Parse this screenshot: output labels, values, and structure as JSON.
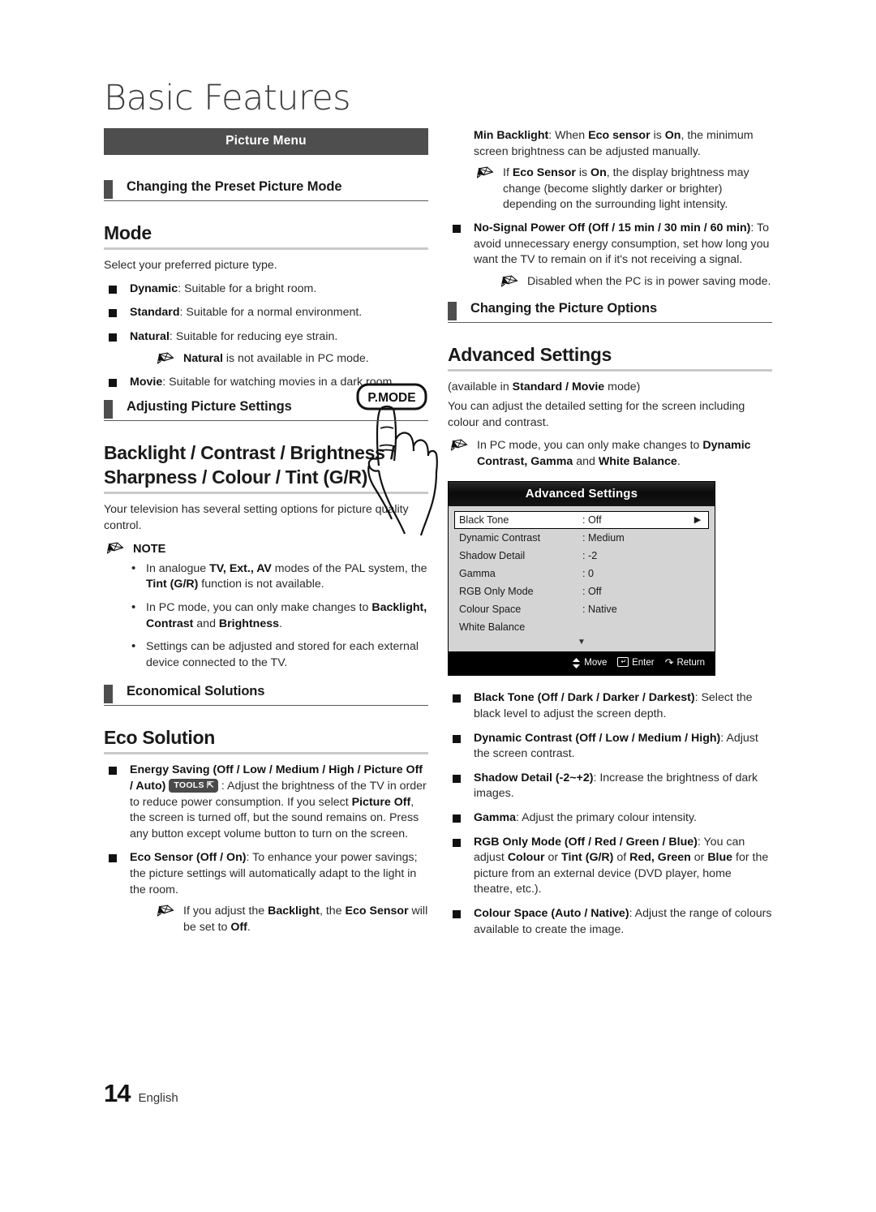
{
  "document": {
    "title": "Basic Features",
    "page_number": "14",
    "language": "English"
  },
  "left_column": {
    "banner": "Picture Menu",
    "section1": {
      "heading": "Changing the Preset Picture Mode",
      "title": "Mode",
      "intro": "Select your preferred picture type.",
      "button_icon_label": "P.MODE",
      "items": [
        {
          "term": "Dynamic",
          "desc": ": Suitable for a bright room."
        },
        {
          "term": "Standard",
          "desc": ": Suitable for a normal environment."
        },
        {
          "term": "Natural",
          "desc": ": Suitable for reducing eye strain."
        },
        {
          "term": "Movie",
          "desc": ": Suitable for watching movies in a dark room."
        }
      ],
      "natural_note_pre": "",
      "natural_note_bold": "Natural",
      "natural_note_post": " is not available in PC mode."
    },
    "section2": {
      "heading": "Adjusting Picture Settings",
      "title_line1": "Backlight / Contrast / Brightness /",
      "title_line2": "Sharpness / Colour / Tint (G/R)",
      "intro": "Your television has several setting options for picture quality control.",
      "note_label": "NOTE",
      "notes": [
        "In analogue TV, Ext., AV modes of the PAL system, the Tint (G/R) function is not available.",
        "In PC mode, you can only make changes to Backlight, Contrast and Brightness.",
        "Settings can be adjusted and stored for each external device connected to the TV."
      ]
    },
    "section3": {
      "heading": "Economical Solutions",
      "title": "Eco Solution",
      "energy_saving": {
        "term": "Energy Saving (Off / Low / Medium / High / Picture Off / Auto)",
        "badge": "TOOLS",
        "desc": ": Adjust the brightness of the TV in order to reduce power consumption. If you select Picture Off, the screen is turned off, but the sound remains on. Press any button except volume button to turn on the screen."
      },
      "eco_sensor": {
        "term": "Eco Sensor (Off / On)",
        "desc": ": To enhance your power savings; the picture settings will automatically adapt to the light in the room."
      },
      "eco_sensor_note": "If you adjust the Backlight, the Eco Sensor will be set to Off."
    }
  },
  "right_column": {
    "min_backlight": {
      "term": "Min Backlight",
      "desc": ": When Eco sensor is On, the minimum screen brightness can be adjusted manually.",
      "note": "If Eco Sensor is On, the display brightness may change (become slightly darker or brighter) depending on the surrounding light intensity."
    },
    "no_signal_power_off": {
      "term": "No-Signal Power Off (Off / 15 min / 30 min / 60 min)",
      "desc": ": To avoid unnecessary energy consumption, set how long you want the TV to remain on if it's not receiving a signal.",
      "note": "Disabled when the PC is in power saving mode."
    },
    "section": {
      "heading": "Changing the Picture Options",
      "title": "Advanced Settings",
      "availability": "(available in Standard / Movie mode)",
      "intro": "You can adjust the detailed setting for the screen including colour and contrast.",
      "note": "In PC mode, you can only make changes to Dynamic Contrast, Gamma and White Balance."
    },
    "osd": {
      "title": "Advanced Settings",
      "rows": [
        {
          "label": "Black Tone",
          "value": ": Off",
          "selected": true,
          "arrow": "▶"
        },
        {
          "label": "Dynamic Contrast",
          "value": ": Medium",
          "selected": false,
          "arrow": ""
        },
        {
          "label": "Shadow Detail",
          "value": ": -2",
          "selected": false,
          "arrow": ""
        },
        {
          "label": "Gamma",
          "value": ": 0",
          "selected": false,
          "arrow": ""
        },
        {
          "label": "RGB Only Mode",
          "value": ": Off",
          "selected": false,
          "arrow": ""
        },
        {
          "label": "Colour Space",
          "value": ": Native",
          "selected": false,
          "arrow": ""
        },
        {
          "label": "White Balance",
          "value": "",
          "selected": false,
          "arrow": ""
        }
      ],
      "scroll_indicator": "▼",
      "footer": {
        "move": "Move",
        "enter": "Enter",
        "return": "Return"
      }
    },
    "options": [
      {
        "term": "Black Tone (Off / Dark / Darker / Darkest)",
        "desc": ": Select the black level to adjust the screen depth."
      },
      {
        "term": "Dynamic Contrast (Off / Low / Medium / High)",
        "desc": ": Adjust the screen contrast."
      },
      {
        "term": "Shadow Detail (-2~+2)",
        "desc": ": Increase the brightness of dark images."
      },
      {
        "term": "Gamma",
        "desc": ": Adjust the primary colour intensity."
      },
      {
        "term": "RGB Only Mode (Off / Red / Green / Blue)",
        "desc": ": You can adjust Colour or Tint (G/R) of Red, Green or Blue for the picture from an external device (DVD player, home theatre, etc.)."
      },
      {
        "term": "Colour Space (Auto / Native)",
        "desc": ": Adjust the range of colours available to create the image."
      }
    ]
  },
  "colors": {
    "banner_bg": "#4e4e4e",
    "tab": "#4e4e4e",
    "rule": "#c9c9c9",
    "osd_body": "#d4d4d4",
    "text": "#231f20"
  }
}
